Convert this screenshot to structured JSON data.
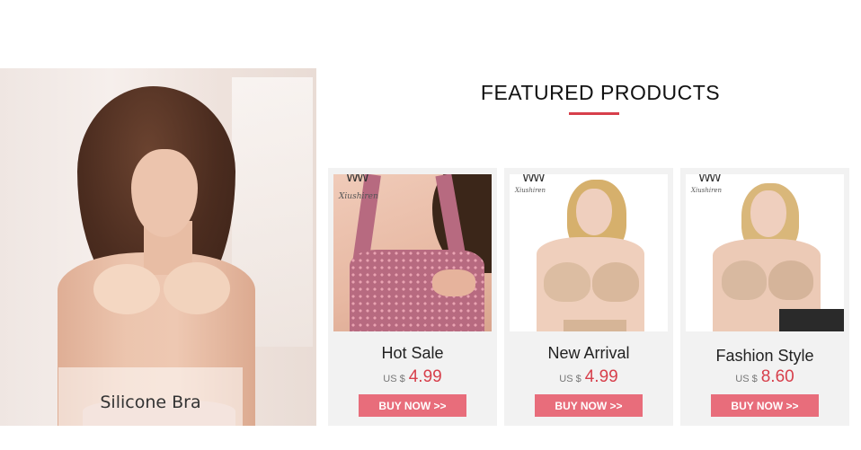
{
  "hero": {
    "label": "Silicone Bra"
  },
  "section": {
    "title": "FEATURED PRODUCTS",
    "accent_color": "#d73f4b"
  },
  "products": [
    {
      "brand": "Xiushiren",
      "name": "Hot Sale",
      "currency": "US $",
      "price": "4.99",
      "button_label": "BUY NOW >>"
    },
    {
      "brand": "Xiushiren",
      "name": "New Arrival",
      "currency": "US $",
      "price": "4.99",
      "button_label": "BUY NOW >>"
    },
    {
      "brand": "Xiushiren",
      "name": "Fashion Style",
      "currency": "US $",
      "price": "8.60",
      "button_label": "BUY NOW >>"
    }
  ],
  "colors": {
    "button_bg": "#e86d7b",
    "price_text": "#d73f4b",
    "card_bg": "#f2f2f2"
  }
}
